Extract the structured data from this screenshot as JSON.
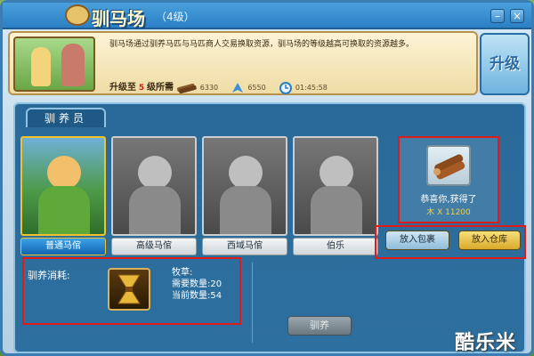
{
  "window": {
    "title": "驯马场",
    "level": "（4级）",
    "minimize_label": "–",
    "close_label": "×"
  },
  "info": {
    "description": "驯马场通过驯养马匹与马匹商人交易换取资源，驯马场的等级越高可换取的资源越多。",
    "upgrade_to_label": "升级至",
    "upgrade_to_level": "5",
    "requirement_label": "级所需",
    "wood_amount": "6330",
    "feather_amount": "6550",
    "time_amount": "01:45:58"
  },
  "upgrade_button": "升级",
  "tabs": [
    {
      "label": "驯养员"
    }
  ],
  "trainers": [
    {
      "label": "普通马倌",
      "active": true
    },
    {
      "label": "高级马倌",
      "active": false
    },
    {
      "label": "西域马倌",
      "active": false
    },
    {
      "label": "伯乐",
      "active": false
    }
  ],
  "reward": {
    "congrats": "恭喜你,获得了",
    "amount": "木 X 11200",
    "icon": "wood-logs-icon"
  },
  "actions": {
    "to_bag": "放入包裹",
    "to_warehouse": "放入仓库"
  },
  "cost": {
    "title": "驯养消耗:",
    "item_name": "牧草:",
    "required_label": "需要数量:20",
    "current_label": "当前数量:54",
    "icon": "hay-bundle-icon"
  },
  "train_button": "驯养",
  "watermark": "酷乐米"
}
